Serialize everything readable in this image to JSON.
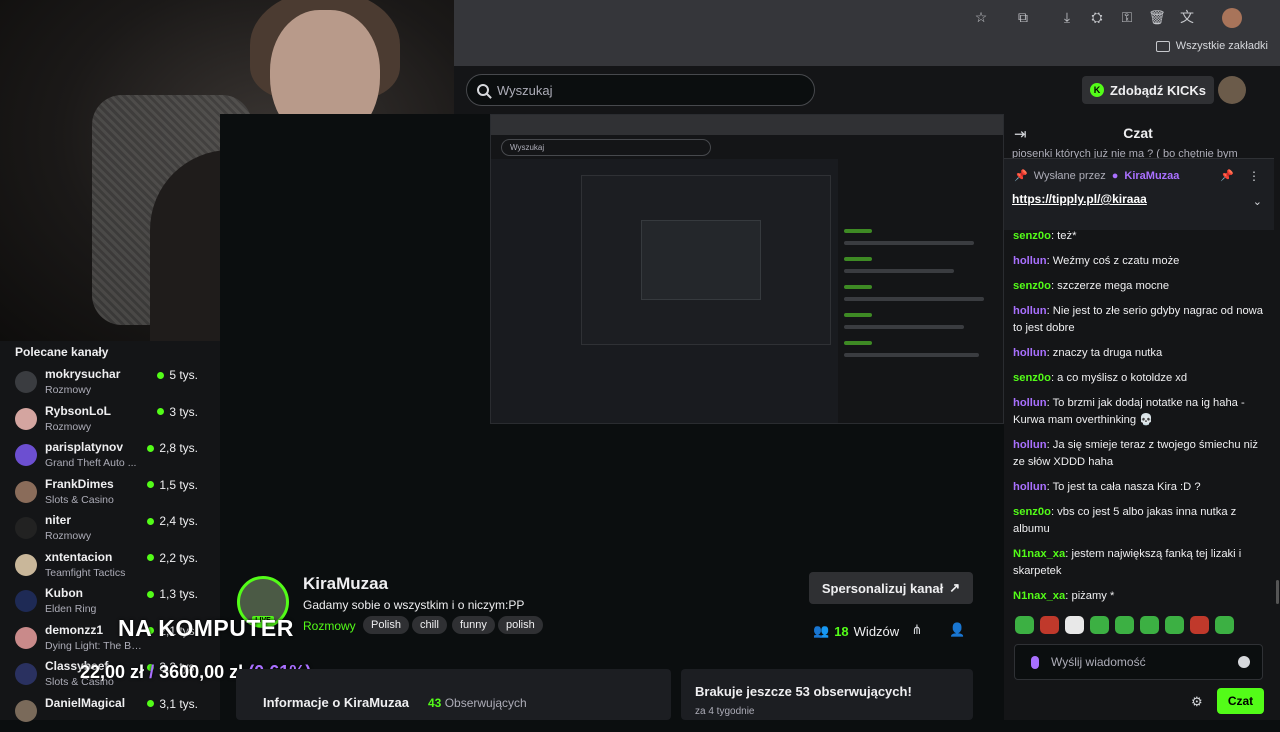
{
  "browser": {
    "bookmarks_label": "Wszystkie zakładki",
    "toolbar_icons": [
      "star-icon",
      "extensions-icon",
      "download-icon",
      "incognito-icon",
      "key-icon",
      "trash-icon",
      "translate-icon",
      "profile-avatar"
    ]
  },
  "header": {
    "search_placeholder": "Wyszukaj",
    "kicks_button": "Zdobądź KICKs"
  },
  "sidebar": {
    "title": "Polecane kanały",
    "channels": [
      {
        "name": "mokrysuchar",
        "category": "Rozmowy",
        "viewers": "5 tys.",
        "color": "#3a3c40"
      },
      {
        "name": "RybsonLoL",
        "category": "Rozmowy",
        "viewers": "3 tys.",
        "color": "#d4a5a0"
      },
      {
        "name": "parisplatynov",
        "category": "Grand Theft Auto ...",
        "viewers": "2,8 tys.",
        "color": "#6c4fd1"
      },
      {
        "name": "FrankDimes",
        "category": "Slots & Casino",
        "viewers": "1,5 tys.",
        "color": "#8a6c5a"
      },
      {
        "name": "niter",
        "category": "Rozmowy",
        "viewers": "2,4 tys.",
        "color": "#222"
      },
      {
        "name": "xntentacion",
        "category": "Teamfight Tactics",
        "viewers": "2,2 tys.",
        "color": "#c9b79a"
      },
      {
        "name": "Kubon",
        "category": "Elden Ring",
        "viewers": "1,3 tys.",
        "color": "#1e2a55"
      },
      {
        "name": "demonzz1",
        "category": "Dying Light: The Beast",
        "viewers": "2,1 tys.",
        "color": "#c98a8a"
      },
      {
        "name": "Classybeef",
        "category": "Slots & Casino",
        "viewers": "3,2 tys.",
        "color": "#2a3160"
      },
      {
        "name": "DanielMagical",
        "category": "",
        "viewers": "3,1 tys.",
        "color": "#7a6a5a"
      }
    ]
  },
  "stream": {
    "streamer": "KiraMuzaa",
    "title": "Gadamy sobie o wszystkim i o niczym:PP",
    "category": "Rozmowy",
    "tags": [
      "Polish",
      "chill",
      "funny",
      "polish"
    ],
    "customize_button": "Spersonalizuj kanał",
    "viewers_count": "18",
    "viewers_label": "Widzów",
    "live_badge": "LIVE"
  },
  "overlay": {
    "text": "NA KOMPUTER",
    "current": "22,00 zł",
    "separator": "/",
    "goal": "3600,00 zł",
    "percent": "(0.61%)"
  },
  "info": {
    "title": "Informacje o KiraMuzaa",
    "followers_count": "43",
    "followers_label": "Obserwujących"
  },
  "goal_card": {
    "title": "Brakuje jeszcze 53 obserwujących!",
    "subtitle": "za 4 tygodnie"
  },
  "chat": {
    "title": "Czat",
    "cut_line": "piosenki których już nie ma ? ( bo chętnie bym",
    "pinned_by_label": "Wysłane przez",
    "pinned_by_user": "KiraMuzaa",
    "pinned_link": "https://tipply.pl/@kiraaa",
    "messages": [
      {
        "user": "senz0o",
        "color": "#53fc18",
        "text": "też*"
      },
      {
        "user": "hollun",
        "color": "#a970ff",
        "text": "Weźmy coś z czatu może"
      },
      {
        "user": "senz0o",
        "color": "#53fc18",
        "text": "szczerze mega mocne"
      },
      {
        "user": "hollun",
        "color": "#a970ff",
        "text": "Nie jest to złe serio gdyby nagrac od nowa to jest dobre"
      },
      {
        "user": "hollun",
        "color": "#a970ff",
        "text": "znaczy ta druga nutka"
      },
      {
        "user": "senz0o",
        "color": "#53fc18",
        "text": "a co myślisz o kotoldze xd"
      },
      {
        "user": "hollun",
        "color": "#a970ff",
        "text": "To brzmi jak dodaj notatke na ig haha - Kurwa mam overthinking 💀"
      },
      {
        "user": "hollun",
        "color": "#a970ff",
        "text": "Ja się smieje teraz z twojego śmiechu niż ze słów XDDD haha"
      },
      {
        "user": "hollun",
        "color": "#a970ff",
        "text": "To jest ta cała nasza Kira :D ?"
      },
      {
        "user": "senz0o",
        "color": "#53fc18",
        "text": "vbs co jest 5 albo jakas inna nutka z albumu"
      },
      {
        "user": "N1nax_xa",
        "color": "#53fc18",
        "text": "jestem największą fanką tej lizaki i skarpetek"
      },
      {
        "user": "N1nax_xa",
        "color": "#53fc18",
        "text": "piżamy *"
      }
    ],
    "emotes": [
      "#3cb043",
      "#c0392b",
      "#e8e8e8",
      "#3cb043",
      "#3cb043",
      "#3cb043",
      "#3cb043",
      "#c0392b",
      "#3cb043"
    ],
    "input_placeholder": "Wyślij wiadomość",
    "send_button": "Czat"
  }
}
